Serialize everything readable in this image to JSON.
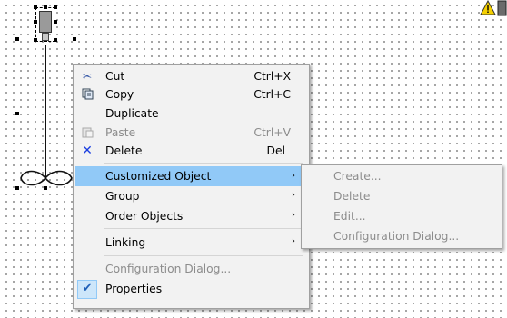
{
  "context_menu": {
    "items": [
      {
        "label": "Cut",
        "shortcut": "Ctrl+X",
        "icon": "scissors-icon"
      },
      {
        "label": "Copy",
        "shortcut": "Ctrl+C",
        "icon": "copy-icon"
      },
      {
        "label": "Duplicate",
        "shortcut": ""
      },
      {
        "label": "Paste",
        "shortcut": "Ctrl+V",
        "icon": "paste-icon",
        "disabled": true
      },
      {
        "label": "Delete",
        "shortcut": "Del",
        "icon": "delete-x-icon"
      },
      {
        "label": "Customized Object",
        "submenu": true,
        "highlighted": true
      },
      {
        "label": "Group",
        "submenu": true
      },
      {
        "label": "Order Objects",
        "submenu": true
      },
      {
        "label": "Linking",
        "submenu": true
      },
      {
        "label": "Configuration Dialog...",
        "disabled": true
      },
      {
        "label": "Properties",
        "checked": true,
        "icon": "checkmark-icon"
      }
    ]
  },
  "submenu": {
    "items": [
      {
        "label": "Create...",
        "disabled": true
      },
      {
        "label": "Delete",
        "disabled": true
      },
      {
        "label": "Edit...",
        "disabled": true
      },
      {
        "label": "Configuration Dialog...",
        "disabled": true
      }
    ]
  },
  "colors": {
    "highlight": "#91c9f7",
    "menu_bg": "#f2f2f2",
    "disabled_text": "#8c8c8c",
    "delete_icon": "#1a3ee0",
    "warning": "#f5d000"
  }
}
